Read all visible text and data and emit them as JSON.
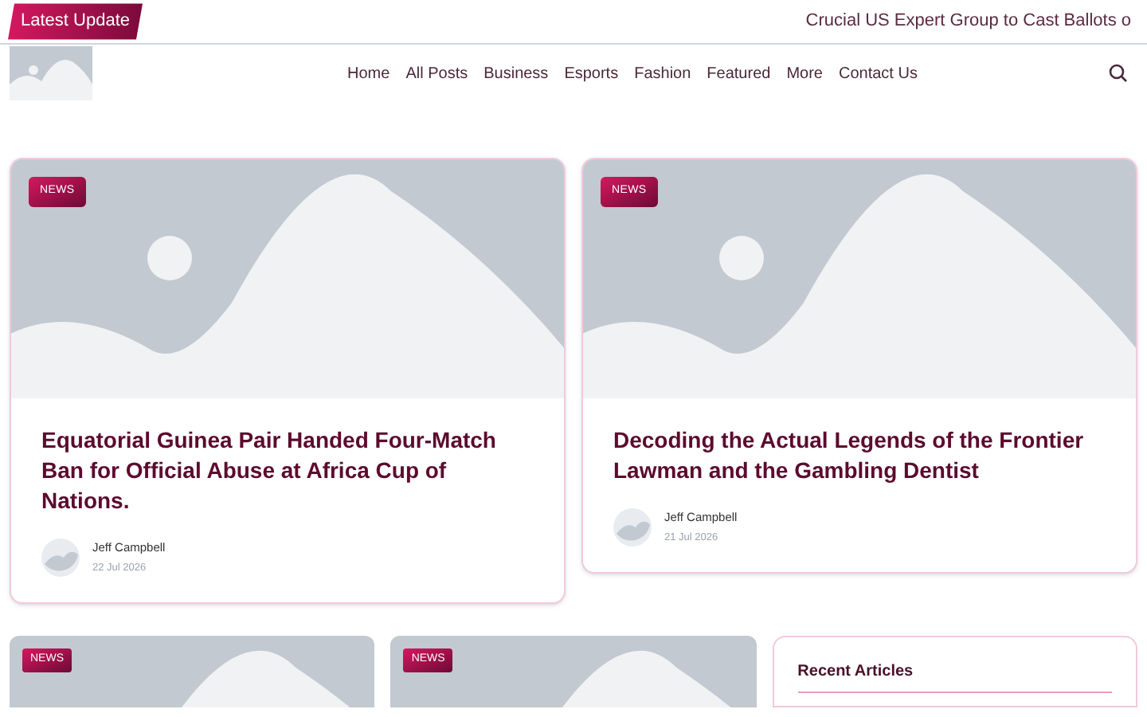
{
  "top_bar": {
    "label": "Latest Update",
    "ticker": "Crucial US Expert Group to Cast Ballots o"
  },
  "nav": {
    "items": [
      "Home",
      "All Posts",
      "Business",
      "Esports",
      "Fashion",
      "Featured",
      "More",
      "Contact Us"
    ]
  },
  "featured_posts": [
    {
      "category": "NEWS",
      "title": "Equatorial Guinea Pair Handed Four-Match Ban for Official Abuse at Africa Cup of Nations.",
      "author": "Jeff Campbell",
      "date": "22 Jul 2026"
    },
    {
      "category": "NEWS",
      "title": "Decoding the Actual Legends of the Frontier Lawman and the Gambling Dentist",
      "author": "Jeff Campbell",
      "date": "21 Jul 2026"
    }
  ],
  "more_posts": [
    {
      "category": "NEWS"
    },
    {
      "category": "NEWS"
    }
  ],
  "sidebar": {
    "title": "Recent Articles"
  }
}
